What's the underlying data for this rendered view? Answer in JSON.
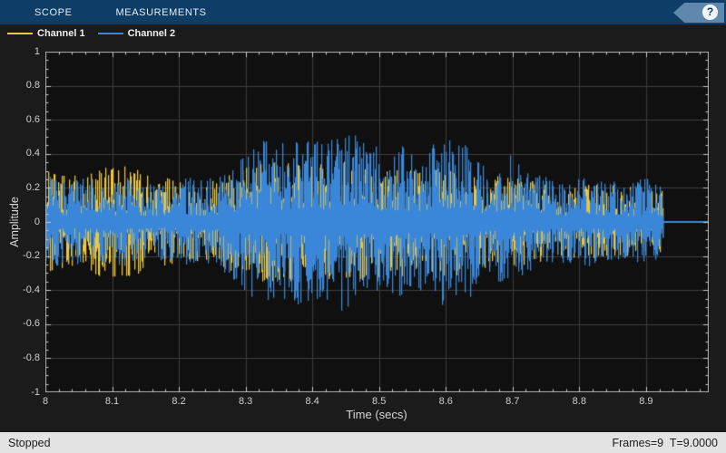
{
  "toolbar": {
    "tabs": [
      {
        "label": "SCOPE"
      },
      {
        "label": "MEASUREMENTS"
      }
    ],
    "help_glyph": "?",
    "bg_color": "#0e3e67",
    "help_bg_color": "#5e88ae"
  },
  "legend": {
    "items": [
      {
        "label": "Channel 1",
        "color": "#edc73f"
      },
      {
        "label": "Channel 2",
        "color": "#3a87d9"
      }
    ]
  },
  "statusbar": {
    "left": "Stopped",
    "right": "Frames=9  T=9.0000"
  },
  "chart_data": {
    "type": "line",
    "title": "",
    "xlabel": "Time (secs)",
    "ylabel": "Amplitude",
    "xlim": [
      8,
      8.994
    ],
    "ylim": [
      -1,
      1
    ],
    "xticks": [
      8,
      8.1,
      8.2,
      8.3,
      8.4,
      8.5,
      8.6,
      8.7,
      8.8,
      8.9
    ],
    "xtick_labels": [
      "8",
      "8.1",
      "8.2",
      "8.3",
      "8.4",
      "8.5",
      "8.6",
      "8.7",
      "8.8",
      "8.9"
    ],
    "yticks": [
      -1,
      -0.8,
      -0.6,
      -0.4,
      -0.2,
      0,
      0.2,
      0.4,
      0.6,
      0.8,
      1
    ],
    "ytick_labels": [
      "-1",
      "-0.8",
      "-0.6",
      "-0.4",
      "-0.2",
      "0",
      "0.2",
      "0.4",
      "0.6",
      "0.8",
      "1"
    ],
    "x_minor_step": 0.02,
    "y_minor_step": 0.05,
    "grid": true,
    "legend_position": "top-left-bar",
    "signal_end_t": 8.925,
    "flat_value": 0,
    "series": [
      {
        "name": "Channel 1",
        "color": "#edc73f",
        "envelope_t": [
          8.0,
          8.03,
          8.06,
          8.09,
          8.12,
          8.15,
          8.18,
          8.21,
          8.24,
          8.27,
          8.3,
          8.33,
          8.36,
          8.39,
          8.42,
          8.45,
          8.48,
          8.51,
          8.54,
          8.57,
          8.6,
          8.63,
          8.66,
          8.69,
          8.72,
          8.75,
          8.78,
          8.81,
          8.84,
          8.87,
          8.9,
          8.925
        ],
        "envelope_a": [
          0.3,
          0.27,
          0.29,
          0.33,
          0.34,
          0.29,
          0.26,
          0.24,
          0.22,
          0.27,
          0.33,
          0.36,
          0.35,
          0.36,
          0.34,
          0.36,
          0.33,
          0.34,
          0.32,
          0.31,
          0.32,
          0.31,
          0.27,
          0.27,
          0.25,
          0.23,
          0.21,
          0.22,
          0.21,
          0.21,
          0.22,
          0.19
        ]
      },
      {
        "name": "Channel 2",
        "color": "#3a87d9",
        "envelope_t": [
          8.0,
          8.03,
          8.06,
          8.09,
          8.12,
          8.15,
          8.18,
          8.21,
          8.24,
          8.27,
          8.3,
          8.33,
          8.36,
          8.39,
          8.42,
          8.45,
          8.48,
          8.51,
          8.54,
          8.57,
          8.6,
          8.63,
          8.66,
          8.69,
          8.72,
          8.75,
          8.78,
          8.81,
          8.84,
          8.87,
          8.9,
          8.925
        ],
        "envelope_a": [
          0.28,
          0.24,
          0.26,
          0.24,
          0.26,
          0.24,
          0.22,
          0.26,
          0.24,
          0.3,
          0.42,
          0.5,
          0.46,
          0.5,
          0.46,
          0.55,
          0.46,
          0.42,
          0.44,
          0.42,
          0.5,
          0.48,
          0.3,
          0.42,
          0.3,
          0.26,
          0.24,
          0.26,
          0.24,
          0.24,
          0.26,
          0.22
        ]
      }
    ],
    "colors": {
      "axes_bg": "#101010",
      "grid": "#3d3d3d",
      "axis_border": "#b2b2b2",
      "tick": "#c9c9c9",
      "tick_label": "#cfcfcf"
    }
  }
}
